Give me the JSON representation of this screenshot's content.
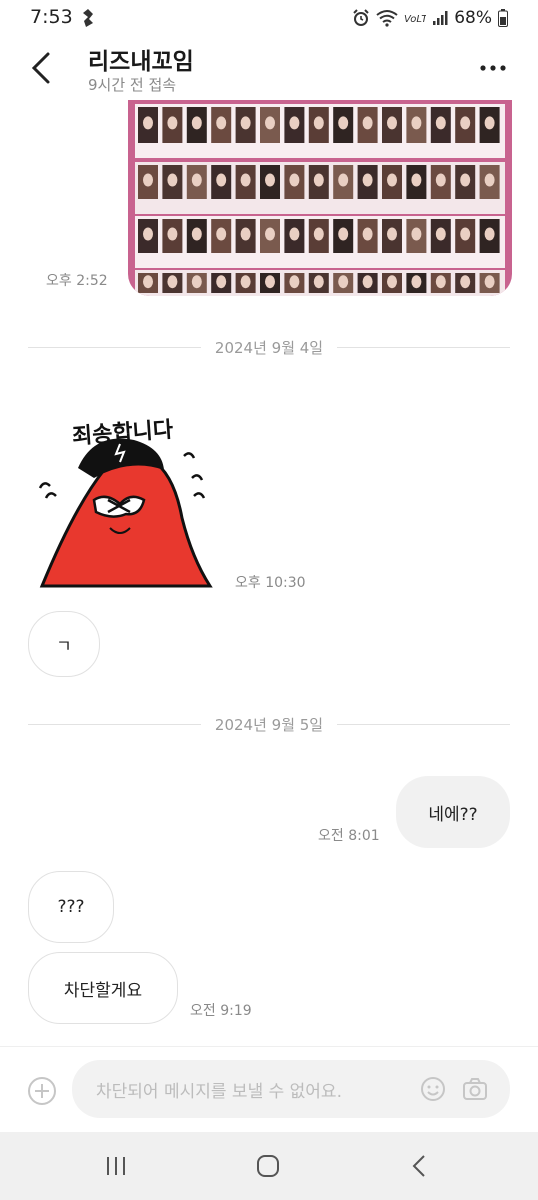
{
  "status_bar": {
    "time": "7:53",
    "battery": "68%"
  },
  "header": {
    "title": "리즈내꼬임",
    "subtitle": "9시간 전 접속"
  },
  "messages": {
    "image_time": "오후 2:52",
    "date1": "2024년 9월 4일",
    "sticker_text": "죄송합니다",
    "sticker_time": "오후 10:30",
    "msg_giyeok": "ㄱ",
    "date2": "2024년 9월 5일",
    "msg_ne": "네에??",
    "msg_ne_time": "오전 8:01",
    "msg_qqq": "???",
    "msg_block": "차단할게요",
    "msg_block_time": "오전 9:19"
  },
  "input": {
    "placeholder": "차단되어 메시지를 보낼 수 없어요."
  },
  "colors": {
    "image_bg": "#c8638f",
    "sticker_red": "#e8382e",
    "bubble_out": "#f1f1f1"
  }
}
